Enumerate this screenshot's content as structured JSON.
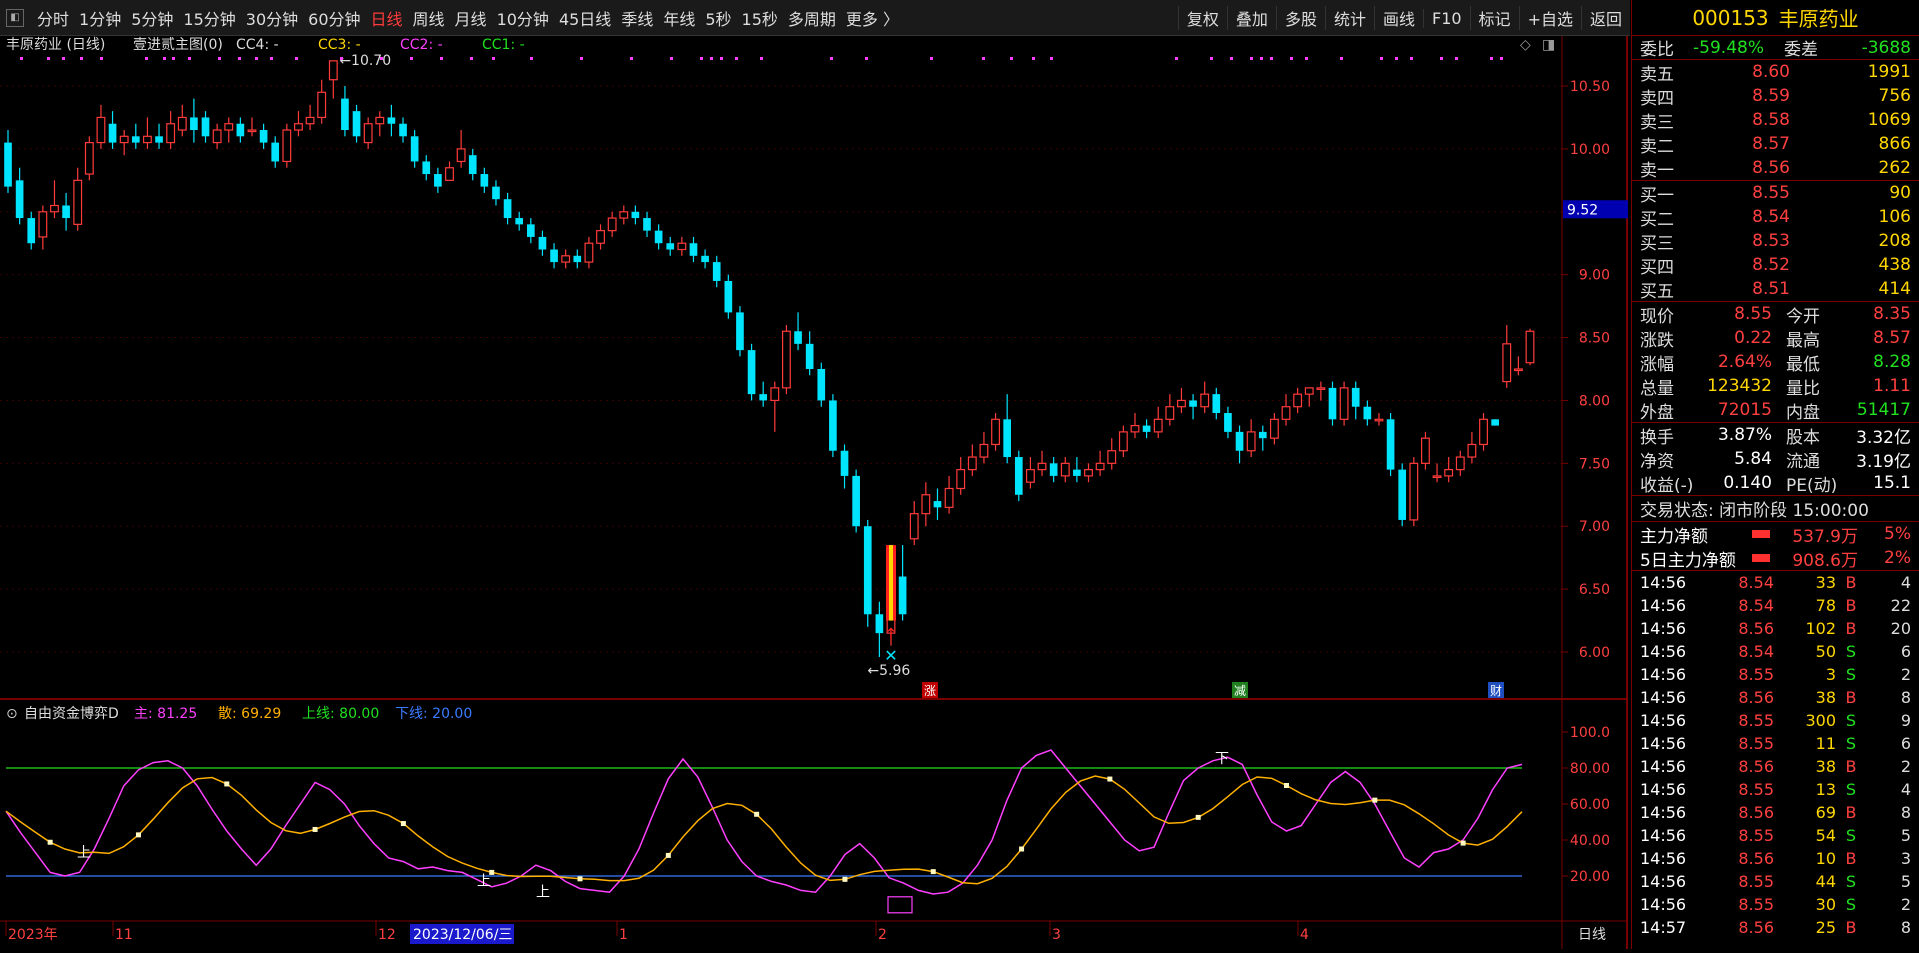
{
  "toolbar": {
    "periods": [
      "分时",
      "1分钟",
      "5分钟",
      "15分钟",
      "30分钟",
      "60分钟",
      "日线",
      "周线",
      "月线",
      "10分钟",
      "45日线",
      "季线",
      "年线",
      "5秒",
      "15秒",
      "多周期",
      "更多 〉"
    ],
    "active_period": "日线",
    "right_buttons": [
      "复权",
      "叠加",
      "多股",
      "统计",
      "画线",
      "F10",
      "标记",
      "+自选",
      "返回"
    ]
  },
  "chart_header": {
    "stock": "丰原药业 (日线)",
    "template": "壹进贰主图(0)",
    "indicators": [
      {
        "label": "CC4: -",
        "color": "#dddddd"
      },
      {
        "label": "CC3: -",
        "color": "#ffd700"
      },
      {
        "label": "CC2: -",
        "color": "#ff40ff"
      },
      {
        "label": "CC1: -",
        "color": "#20e020"
      }
    ]
  },
  "price_axis": {
    "ticks": [
      "10.50",
      "10.00",
      "9.50",
      "9.00",
      "8.50",
      "8.00",
      "7.50",
      "7.00",
      "6.50",
      "6.00"
    ],
    "current_marker": "9.52",
    "high_label": "10.70",
    "low_label": "5.96"
  },
  "event_markers": [
    "涨",
    "减",
    "财"
  ],
  "osc_header": {
    "name": "自由资金博弈D",
    "items": [
      {
        "label": "主: 81.25",
        "color": "#ff40ff"
      },
      {
        "label": "散: 69.29",
        "color": "#ffb000"
      },
      {
        "label": "上线: 80.00",
        "color": "#20e020"
      },
      {
        "label": "下线: 20.00",
        "color": "#3b7bff"
      }
    ]
  },
  "osc_axis": {
    "ticks": [
      "100.0",
      "80.00",
      "60.00",
      "40.00",
      "20.00"
    ]
  },
  "osc_signals": [
    "上",
    "上",
    "上",
    "下"
  ],
  "date_axis": {
    "labels": [
      "2023年",
      "11",
      "12",
      "1",
      "2",
      "3",
      "4"
    ],
    "cursor_date": "2023/12/06/三",
    "period_label": "日线"
  },
  "quote": {
    "code": "000153",
    "name": "丰原药业",
    "weibi": {
      "label": "委比",
      "value": "-59.48%"
    },
    "weicha": {
      "label": "委差",
      "value": "-3688"
    },
    "asks": [
      {
        "label": "卖五",
        "price": "8.60",
        "vol": "1991"
      },
      {
        "label": "卖四",
        "price": "8.59",
        "vol": "756"
      },
      {
        "label": "卖三",
        "price": "8.58",
        "vol": "1069"
      },
      {
        "label": "卖二",
        "price": "8.57",
        "vol": "866"
      },
      {
        "label": "卖一",
        "price": "8.56",
        "vol": "262"
      }
    ],
    "bids": [
      {
        "label": "买一",
        "price": "8.55",
        "vol": "90"
      },
      {
        "label": "买二",
        "price": "8.54",
        "vol": "106"
      },
      {
        "label": "买三",
        "price": "8.53",
        "vol": "208"
      },
      {
        "label": "买四",
        "price": "8.52",
        "vol": "438"
      },
      {
        "label": "买五",
        "price": "8.51",
        "vol": "414"
      }
    ],
    "stats": [
      {
        "l1": "现价",
        "v1": "8.55",
        "c1": "red",
        "l2": "今开",
        "v2": "8.35",
        "c2": "red"
      },
      {
        "l1": "涨跌",
        "v1": "0.22",
        "c1": "red",
        "l2": "最高",
        "v2": "8.57",
        "c2": "red"
      },
      {
        "l1": "涨幅",
        "v1": "2.64%",
        "c1": "red",
        "l2": "最低",
        "v2": "8.28",
        "c2": "green"
      },
      {
        "l1": "总量",
        "v1": "123432",
        "c1": "yellow",
        "l2": "量比",
        "v2": "1.11",
        "c2": "red"
      },
      {
        "l1": "外盘",
        "v1": "72015",
        "c1": "red",
        "l2": "内盘",
        "v2": "51417",
        "c2": "green"
      }
    ],
    "stats2": [
      {
        "l1": "换手",
        "v1": "3.87%",
        "l2": "股本",
        "v2": "3.32亿"
      },
      {
        "l1": "净资",
        "v1": "5.84",
        "l2": "流通",
        "v2": "3.19亿"
      },
      {
        "l1": "收益(-)",
        "v1": "0.140",
        "l2": "PE(动)",
        "v2": "15.1"
      }
    ],
    "trade_status": "交易状态: 闭市阶段 15:00:00",
    "flows": [
      {
        "label": "主力净额",
        "value": "537.9万",
        "pct": "5%"
      },
      {
        "label": "5日主力净额",
        "value": "908.6万",
        "pct": "2%"
      }
    ],
    "ticks": [
      {
        "t": "14:56",
        "p": "8.54",
        "pc": "red",
        "v": "33",
        "bs": "B",
        "n": "4"
      },
      {
        "t": "14:56",
        "p": "8.54",
        "pc": "red",
        "v": "78",
        "bs": "B",
        "n": "22"
      },
      {
        "t": "14:56",
        "p": "8.56",
        "pc": "red",
        "v": "102",
        "bs": "B",
        "n": "20"
      },
      {
        "t": "14:56",
        "p": "8.54",
        "pc": "red",
        "v": "50",
        "bs": "S",
        "n": "6"
      },
      {
        "t": "14:56",
        "p": "8.55",
        "pc": "red",
        "v": "3",
        "bs": "S",
        "n": "2"
      },
      {
        "t": "14:56",
        "p": "8.56",
        "pc": "red",
        "v": "38",
        "bs": "B",
        "n": "8"
      },
      {
        "t": "14:56",
        "p": "8.55",
        "pc": "red",
        "v": "300",
        "bs": "S",
        "n": "9"
      },
      {
        "t": "14:56",
        "p": "8.55",
        "pc": "red",
        "v": "11",
        "bs": "S",
        "n": "6"
      },
      {
        "t": "14:56",
        "p": "8.56",
        "pc": "red",
        "v": "38",
        "bs": "B",
        "n": "2"
      },
      {
        "t": "14:56",
        "p": "8.55",
        "pc": "red",
        "v": "13",
        "bs": "S",
        "n": "4"
      },
      {
        "t": "14:56",
        "p": "8.56",
        "pc": "red",
        "v": "69",
        "bs": "B",
        "n": "8"
      },
      {
        "t": "14:56",
        "p": "8.55",
        "pc": "red",
        "v": "54",
        "bs": "S",
        "n": "5"
      },
      {
        "t": "14:56",
        "p": "8.56",
        "pc": "red",
        "v": "10",
        "bs": "B",
        "n": "3"
      },
      {
        "t": "14:56",
        "p": "8.55",
        "pc": "red",
        "v": "44",
        "bs": "S",
        "n": "5"
      },
      {
        "t": "14:56",
        "p": "8.55",
        "pc": "red",
        "v": "30",
        "bs": "S",
        "n": "2"
      },
      {
        "t": "14:57",
        "p": "8.56",
        "pc": "red",
        "v": "25",
        "bs": "B",
        "n": "8"
      }
    ]
  },
  "chart_data": {
    "type": "candlestick",
    "xlabel": "",
    "ylabel": "",
    "ylim": [
      5.8,
      10.8
    ],
    "candles": [
      [
        10.05,
        9.7,
        10.15,
        9.65
      ],
      [
        9.75,
        9.45,
        9.85,
        9.4
      ],
      [
        9.45,
        9.25,
        9.5,
        9.2
      ],
      [
        9.3,
        9.5,
        9.55,
        9.2
      ],
      [
        9.5,
        9.55,
        9.75,
        9.45
      ],
      [
        9.55,
        9.45,
        9.65,
        9.35
      ],
      [
        9.4,
        9.75,
        9.85,
        9.35
      ],
      [
        9.8,
        10.05,
        10.1,
        9.75
      ],
      [
        10.05,
        10.25,
        10.35,
        10.0
      ],
      [
        10.2,
        10.05,
        10.3,
        10.0
      ],
      [
        10.05,
        10.1,
        10.15,
        9.95
      ],
      [
        10.1,
        10.05,
        10.2,
        10.0
      ],
      [
        10.05,
        10.1,
        10.25,
        10.0
      ],
      [
        10.1,
        10.05,
        10.2,
        10.0
      ],
      [
        10.05,
        10.2,
        10.3,
        10.0
      ],
      [
        10.15,
        10.25,
        10.35,
        10.1
      ],
      [
        10.25,
        10.15,
        10.4,
        10.05
      ],
      [
        10.25,
        10.1,
        10.3,
        10.05
      ],
      [
        10.05,
        10.15,
        10.2,
        10.0
      ],
      [
        10.15,
        10.2,
        10.25,
        10.05
      ],
      [
        10.2,
        10.1,
        10.25,
        10.05
      ],
      [
        10.15,
        10.15,
        10.25,
        10.1
      ],
      [
        10.15,
        10.05,
        10.2,
        10.0
      ],
      [
        10.05,
        9.9,
        10.1,
        9.85
      ],
      [
        9.9,
        10.15,
        10.2,
        9.85
      ],
      [
        10.15,
        10.2,
        10.3,
        10.1
      ],
      [
        10.2,
        10.25,
        10.35,
        10.15
      ],
      [
        10.25,
        10.45,
        10.55,
        10.2
      ],
      [
        10.55,
        10.7,
        10.7,
        10.4
      ],
      [
        10.4,
        10.15,
        10.5,
        10.1
      ],
      [
        10.3,
        10.1,
        10.35,
        10.05
      ],
      [
        10.05,
        10.2,
        10.25,
        10.0
      ],
      [
        10.2,
        10.25,
        10.3,
        10.1
      ],
      [
        10.25,
        10.2,
        10.35,
        10.1
      ],
      [
        10.2,
        10.1,
        10.25,
        10.05
      ],
      [
        10.1,
        9.9,
        10.15,
        9.85
      ],
      [
        9.9,
        9.8,
        9.95,
        9.75
      ],
      [
        9.8,
        9.7,
        9.85,
        9.65
      ],
      [
        9.75,
        9.85,
        9.9,
        9.75
      ],
      [
        9.9,
        10.0,
        10.15,
        9.85
      ],
      [
        9.95,
        9.8,
        10.0,
        9.75
      ],
      [
        9.8,
        9.7,
        9.85,
        9.65
      ],
      [
        9.7,
        9.6,
        9.75,
        9.55
      ],
      [
        9.6,
        9.45,
        9.65,
        9.4
      ],
      [
        9.45,
        9.4,
        9.5,
        9.35
      ],
      [
        9.4,
        9.3,
        9.45,
        9.25
      ],
      [
        9.3,
        9.2,
        9.35,
        9.15
      ],
      [
        9.2,
        9.1,
        9.25,
        9.05
      ],
      [
        9.1,
        9.15,
        9.2,
        9.05
      ],
      [
        9.15,
        9.1,
        9.2,
        9.05
      ],
      [
        9.1,
        9.25,
        9.3,
        9.05
      ],
      [
        9.25,
        9.35,
        9.4,
        9.2
      ],
      [
        9.35,
        9.45,
        9.5,
        9.3
      ],
      [
        9.45,
        9.5,
        9.55,
        9.4
      ],
      [
        9.5,
        9.45,
        9.55,
        9.4
      ],
      [
        9.45,
        9.35,
        9.5,
        9.3
      ],
      [
        9.35,
        9.25,
        9.4,
        9.2
      ],
      [
        9.25,
        9.2,
        9.3,
        9.15
      ],
      [
        9.2,
        9.25,
        9.3,
        9.15
      ],
      [
        9.25,
        9.15,
        9.3,
        9.1
      ],
      [
        9.15,
        9.1,
        9.2,
        9.05
      ],
      [
        9.1,
        8.95,
        9.15,
        8.9
      ],
      [
        8.95,
        8.7,
        9.0,
        8.65
      ],
      [
        8.7,
        8.4,
        8.75,
        8.35
      ],
      [
        8.4,
        8.05,
        8.45,
        8.0
      ],
      [
        8.05,
        8.0,
        8.15,
        7.95
      ],
      [
        8.0,
        8.1,
        8.15,
        7.75
      ],
      [
        8.1,
        8.55,
        8.6,
        8.05
      ],
      [
        8.55,
        8.45,
        8.7,
        8.4
      ],
      [
        8.45,
        8.25,
        8.55,
        8.2
      ],
      [
        8.25,
        8.0,
        8.3,
        7.95
      ],
      [
        8.0,
        7.6,
        8.05,
        7.55
      ],
      [
        7.6,
        7.4,
        7.65,
        7.3
      ],
      [
        7.4,
        7.0,
        7.45,
        6.95
      ],
      [
        7.0,
        6.3,
        7.05,
        6.2
      ],
      [
        6.3,
        6.15,
        6.4,
        5.96
      ],
      [
        6.15,
        6.6,
        6.65,
        6.05
      ],
      [
        6.6,
        6.3,
        6.85,
        6.25
      ],
      [
        6.9,
        7.1,
        7.2,
        6.85
      ],
      [
        7.1,
        7.25,
        7.35,
        7.0
      ],
      [
        7.2,
        7.15,
        7.3,
        7.05
      ],
      [
        7.15,
        7.3,
        7.4,
        7.1
      ],
      [
        7.3,
        7.45,
        7.55,
        7.25
      ],
      [
        7.45,
        7.55,
        7.65,
        7.4
      ],
      [
        7.55,
        7.65,
        7.75,
        7.5
      ],
      [
        7.65,
        7.85,
        7.9,
        7.6
      ],
      [
        7.85,
        7.55,
        8.05,
        7.5
      ],
      [
        7.55,
        7.25,
        7.6,
        7.2
      ],
      [
        7.35,
        7.45,
        7.55,
        7.3
      ],
      [
        7.45,
        7.5,
        7.6,
        7.4
      ],
      [
        7.5,
        7.4,
        7.55,
        7.35
      ],
      [
        7.4,
        7.5,
        7.55,
        7.35
      ],
      [
        7.45,
        7.4,
        7.55,
        7.35
      ],
      [
        7.4,
        7.45,
        7.5,
        7.35
      ],
      [
        7.45,
        7.5,
        7.6,
        7.4
      ],
      [
        7.5,
        7.6,
        7.7,
        7.45
      ],
      [
        7.6,
        7.75,
        7.8,
        7.55
      ],
      [
        7.75,
        7.8,
        7.9,
        7.7
      ],
      [
        7.8,
        7.75,
        7.85,
        7.7
      ],
      [
        7.75,
        7.85,
        7.95,
        7.7
      ],
      [
        7.85,
        7.95,
        8.05,
        7.8
      ],
      [
        7.95,
        8.0,
        8.1,
        7.9
      ],
      [
        8.0,
        7.95,
        8.05,
        7.85
      ],
      [
        7.95,
        8.05,
        8.15,
        7.9
      ],
      [
        8.05,
        7.9,
        8.1,
        7.85
      ],
      [
        7.9,
        7.75,
        7.95,
        7.7
      ],
      [
        7.75,
        7.6,
        7.8,
        7.5
      ],
      [
        7.6,
        7.75,
        7.85,
        7.55
      ],
      [
        7.75,
        7.7,
        7.8,
        7.6
      ],
      [
        7.7,
        7.85,
        7.9,
        7.65
      ],
      [
        7.85,
        7.95,
        8.05,
        7.8
      ],
      [
        7.95,
        8.05,
        8.1,
        7.9
      ],
      [
        8.05,
        8.1,
        8.1,
        7.95
      ],
      [
        8.1,
        8.1,
        8.15,
        8.0
      ],
      [
        8.1,
        7.85,
        8.15,
        7.8
      ],
      [
        7.85,
        8.1,
        8.15,
        7.8
      ],
      [
        8.1,
        7.95,
        8.15,
        7.85
      ],
      [
        7.95,
        7.85,
        8.0,
        7.8
      ],
      [
        7.85,
        7.85,
        7.9,
        7.8
      ],
      [
        7.85,
        7.45,
        7.9,
        7.4
      ],
      [
        7.45,
        7.05,
        7.5,
        7.0
      ],
      [
        7.05,
        7.5,
        7.55,
        7.0
      ],
      [
        7.5,
        7.7,
        7.75,
        7.45
      ],
      [
        7.4,
        7.4,
        7.5,
        7.35
      ],
      [
        7.4,
        7.45,
        7.55,
        7.35
      ],
      [
        7.45,
        7.55,
        7.6,
        7.4
      ],
      [
        7.55,
        7.65,
        7.75,
        7.5
      ],
      [
        7.65,
        7.85,
        7.9,
        7.6
      ],
      [
        7.85,
        7.8,
        7.85,
        7.8
      ],
      [
        8.15,
        8.45,
        8.6,
        8.1
      ],
      [
        8.25,
        8.25,
        8.35,
        8.2
      ],
      [
        8.3,
        8.55,
        8.57,
        8.28
      ]
    ],
    "osc_main": [
      56,
      44,
      33,
      22,
      20,
      22,
      35,
      52,
      70,
      79,
      83,
      84,
      80,
      70,
      57,
      45,
      35,
      26,
      35,
      48,
      60,
      72,
      68,
      60,
      48,
      38,
      30,
      28,
      24,
      25,
      23,
      22,
      18,
      14,
      16,
      20,
      26,
      23,
      17,
      13,
      12,
      11,
      20,
      35,
      55,
      74,
      85,
      75,
      58,
      40,
      28,
      20,
      17,
      15,
      12,
      11,
      20,
      32,
      38,
      30,
      19,
      16,
      12,
      10,
      11,
      16,
      26,
      40,
      62,
      80,
      87,
      90,
      80,
      70,
      60,
      50,
      40,
      34,
      36,
      55,
      73,
      80,
      84,
      86,
      82,
      65,
      50,
      45,
      48,
      60,
      72,
      78,
      72,
      60,
      45,
      30,
      25,
      33,
      35,
      40,
      52,
      68,
      80,
      82
    ]
  }
}
